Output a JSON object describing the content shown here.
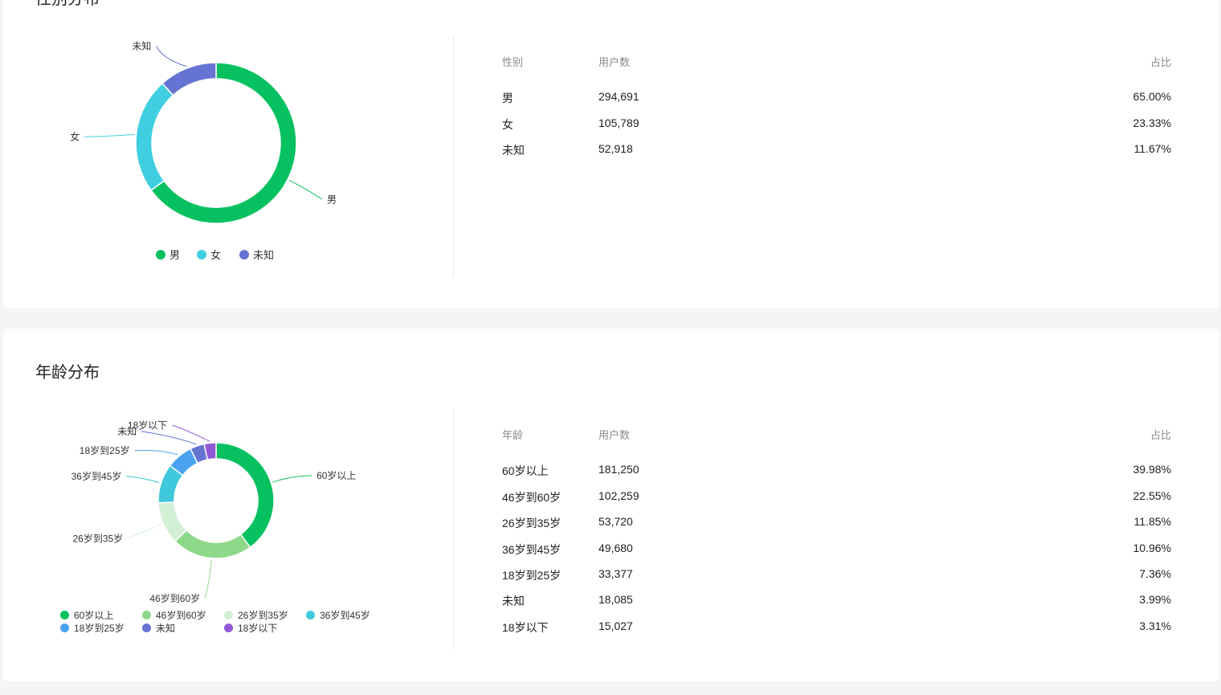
{
  "gender_section": {
    "title": "性别分布",
    "table": {
      "headers": [
        "性别",
        "用户数",
        "占比"
      ],
      "rows": [
        {
          "label": "男",
          "count": "294,691",
          "pct": "65.00%"
        },
        {
          "label": "女",
          "count": "105,789",
          "pct": "23.33%"
        },
        {
          "label": "未知",
          "count": "52,918",
          "pct": "11.67%"
        }
      ]
    }
  },
  "age_section": {
    "title": "年龄分布",
    "table": {
      "headers": [
        "年龄",
        "用户数",
        "占比"
      ],
      "rows": [
        {
          "label": "60岁以上",
          "count": "181,250",
          "pct": "39.98%"
        },
        {
          "label": "46岁到60岁",
          "count": "102,259",
          "pct": "22.55%"
        },
        {
          "label": "26岁到35岁",
          "count": "53,720",
          "pct": "11.85%"
        },
        {
          "label": "36岁到45岁",
          "count": "49,680",
          "pct": "10.96%"
        },
        {
          "label": "18岁到25岁",
          "count": "33,377",
          "pct": "7.36%"
        },
        {
          "label": "未知",
          "count": "18,085",
          "pct": "3.99%"
        },
        {
          "label": "18岁以下",
          "count": "15,027",
          "pct": "3.31%"
        }
      ]
    }
  },
  "chart_data": [
    {
      "type": "pie",
      "categories": [
        "男",
        "女",
        "未知"
      ],
      "values": [
        294691,
        105789,
        52918
      ],
      "colors": [
        "#07c160",
        "#40cfe0",
        "#6574d2"
      ],
      "legend": [
        "男",
        "女",
        "未知"
      ],
      "legend_position": "bottom"
    },
    {
      "type": "pie",
      "categories": [
        "60岁以上",
        "46岁到60岁",
        "26岁到35岁",
        "36岁到45岁",
        "18岁到25岁",
        "未知",
        "18岁以下"
      ],
      "values": [
        181250,
        102259,
        53720,
        49680,
        33377,
        18085,
        15027
      ],
      "colors": [
        "#07c160",
        "#8ed88a",
        "#d3f0d6",
        "#40c8dc",
        "#4aa3ee",
        "#6574d2",
        "#9159d6"
      ],
      "legend": [
        "60岁以上",
        "46岁到60岁",
        "26岁到35岁",
        "36岁到45岁",
        "18岁到25岁",
        "未知",
        "18岁以下"
      ],
      "legend_position": "bottom"
    }
  ]
}
